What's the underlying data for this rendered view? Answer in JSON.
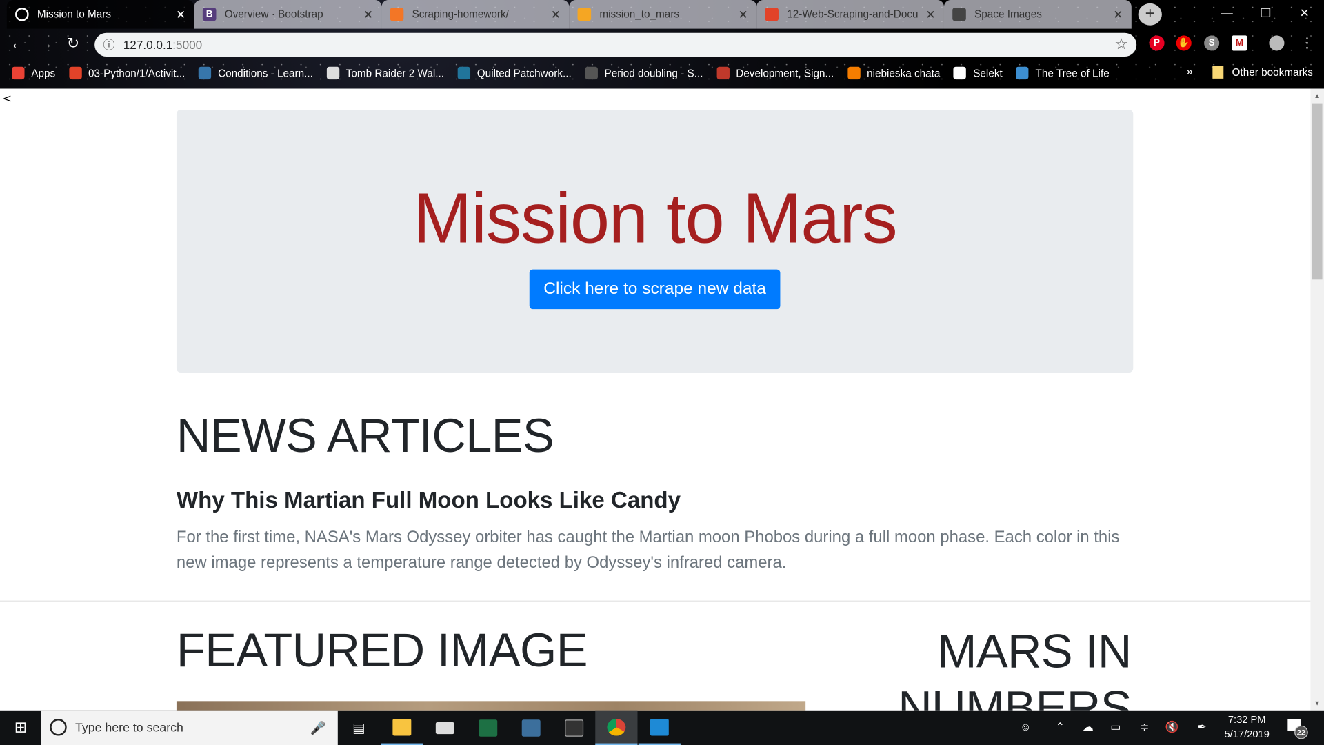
{
  "browser": {
    "tabs": [
      {
        "title": "Mission to Mars",
        "icon": "globe-icon",
        "color": "#ffffff",
        "active": true
      },
      {
        "title": "Overview · Bootstrap",
        "icon": "bootstrap-icon",
        "color": "#563d7c",
        "glyph": "B"
      },
      {
        "title": "Scraping-homework/",
        "icon": "jupyter-icon",
        "color": "#f37626"
      },
      {
        "title": "mission_to_mars",
        "icon": "notebook-icon",
        "color": "#f5a623"
      },
      {
        "title": "12-Web-Scraping-and-Docu",
        "icon": "gitlab-icon",
        "color": "#e24329"
      },
      {
        "title": "Space Images",
        "icon": "space-image-icon",
        "color": "#444444"
      }
    ],
    "url_host": "127.0.0.1",
    "url_port": ":5000",
    "bookmarks": [
      {
        "label": "Apps",
        "color": "#e94235"
      },
      {
        "label": "03-Python/1/Activit...",
        "color": "#e24329"
      },
      {
        "label": "Conditions - Learn...",
        "color": "#3776ab"
      },
      {
        "label": "Tomb Raider 2 Wal...",
        "color": "#dddddd"
      },
      {
        "label": "Quilted Patchwork...",
        "color": "#21759b"
      },
      {
        "label": "Period doubling - S...",
        "color": "#555555"
      },
      {
        "label": "Development, Sign...",
        "color": "#c0392b"
      },
      {
        "label": "niebieska chata",
        "color": "#f57d00"
      },
      {
        "label": "Selekt",
        "color": "#ffffff"
      },
      {
        "label": "The Tree of Life",
        "color": "#3d8fd1"
      }
    ],
    "more_bookmarks": "»",
    "other_bookmarks": "Other bookmarks"
  },
  "page": {
    "back_link": "<",
    "title": "Mission to Mars",
    "scrape_button": "Click here to scrape new data",
    "news_heading": "NEWS ARTICLES",
    "article_title": "Why This Martian Full Moon Looks Like Candy",
    "article_body": "For the first time, NASA's Mars Odyssey orbiter has caught the Martian moon Phobos during a full moon phase. Each color in this new image represents a temperature range detected by Odyssey's infrared camera.",
    "featured_heading": "FEATURED IMAGE",
    "numbers_heading": "MARS IN NUMBERS"
  },
  "taskbar": {
    "search_placeholder": "Type here to search",
    "time": "7:32 PM",
    "date": "5/17/2019",
    "notifications": "22"
  },
  "colors": {
    "title": "#a51f1f",
    "button": "#007bff",
    "jumbotron": "#e9ecef"
  }
}
